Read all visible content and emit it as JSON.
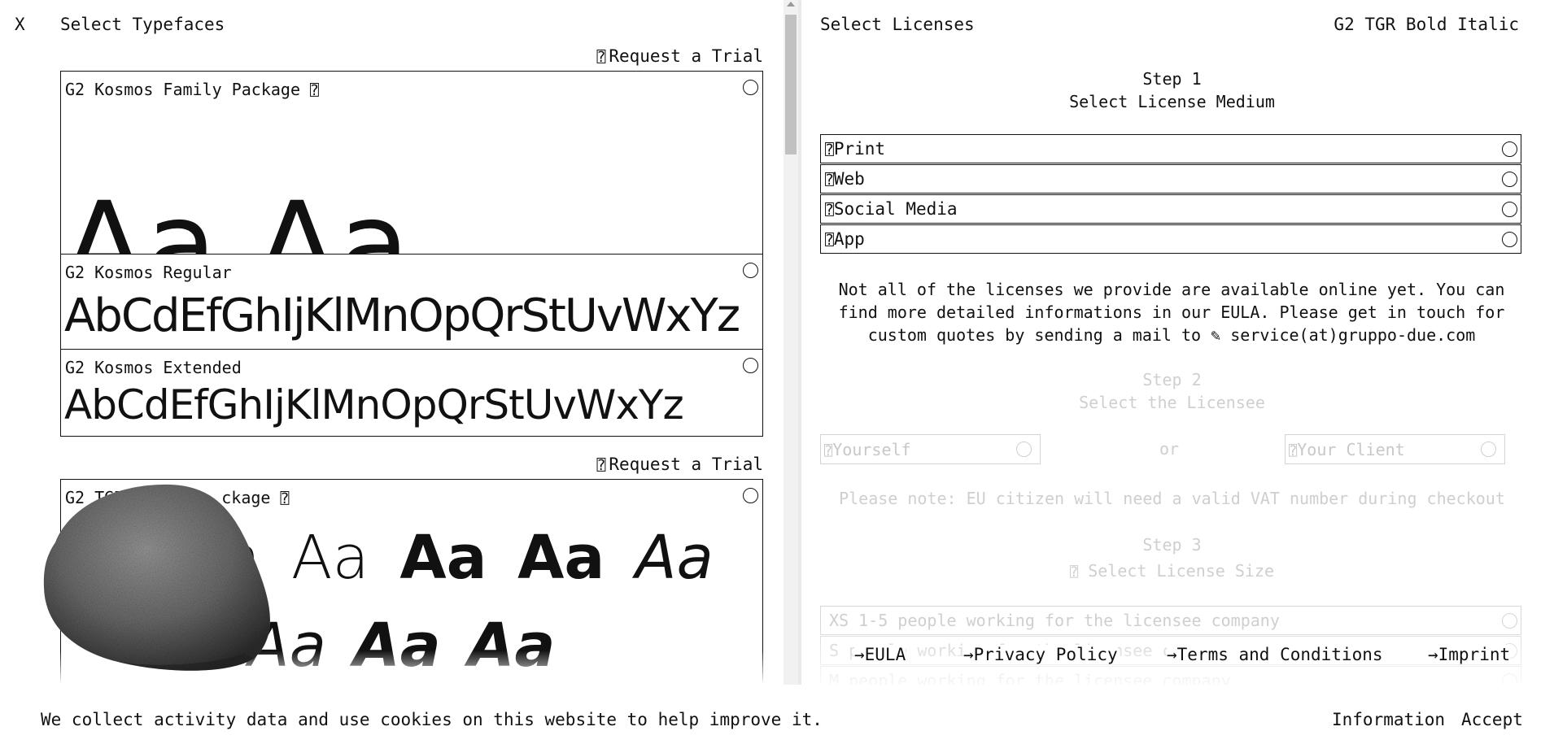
{
  "left": {
    "close_label": "X",
    "title": "Select Typefaces",
    "trial_icon": "flask-icon",
    "trial_label": "Request a Trial",
    "kosmos_family": {
      "title": "G2 Kosmos Family Package",
      "info_icon": "info-icon",
      "specimen": "Aa Aa"
    },
    "kosmos_regular": {
      "title": "G2 Kosmos Regular",
      "specimen": "AbCdEfGhIjKlMnOpQrStUvWxYz"
    },
    "kosmos_extended": {
      "title": "G2 Kosmos Extended",
      "specimen": "AbCdEfGhIjKlMnOpQrStUvWxYz"
    },
    "tgr_family": {
      "title": "G2 TGR Family Package",
      "visible_title_start": "G2 TGR",
      "visible_title_end": "ckage",
      "specimen_row1": [
        "a",
        "Aa",
        "Aa",
        "Aa",
        "Aa"
      ],
      "specimen_row2": [
        "Aa",
        "Aa",
        "Aa"
      ]
    }
  },
  "right": {
    "title": "Select Licenses",
    "selected_font": "G2 TGR Bold Italic",
    "step1": {
      "label": "Step 1",
      "sub": "Select License Medium"
    },
    "mediums": [
      "Print",
      "Web",
      "Social Media",
      "App"
    ],
    "medium_icon": "info-icon",
    "info_text": "Not all of the licenses we provide are available online yet. You can find more detailed informations in our EULA. Please get in touch for custom quotes by sending a mail to",
    "mail_icon": "pen-icon",
    "email": "service(at)gruppo-due.com",
    "step2": {
      "label": "Step 2",
      "sub": "Select the Licensee"
    },
    "licensee": {
      "yourself": "Yourself",
      "or": "or",
      "client": "Your Client"
    },
    "vat_note": "Please note: EU citizen will need a valid VAT number during checkout",
    "step3": {
      "label": "Step 3",
      "sub": "Select License Size"
    },
    "sizes": [
      "XS 1-5 people working for the licensee company",
      "S  people working for the licensee company",
      "M  people working for the licensee company"
    ]
  },
  "footer": {
    "eula": "→EULA",
    "privacy": "→Privacy Policy",
    "terms": "→Terms and Conditions",
    "imprint": "→Imprint"
  },
  "cookie": {
    "text": "We collect activity data and use cookies on this website to help improve it.",
    "info": "Information",
    "accept": "Accept"
  }
}
